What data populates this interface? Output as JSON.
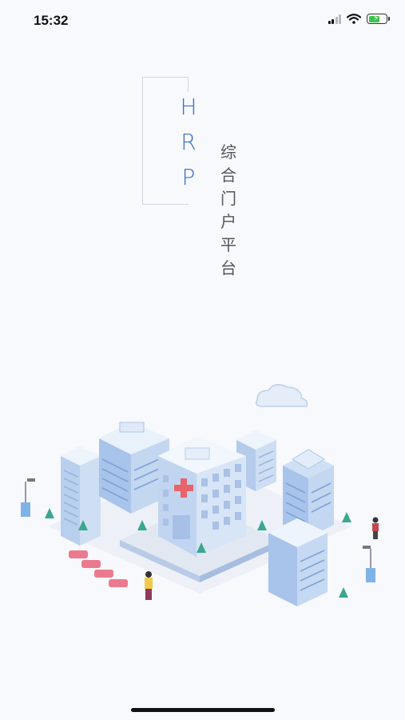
{
  "status_bar": {
    "time": "15:32",
    "battery_level": 0.7
  },
  "brand": {
    "letters": [
      "H",
      "R",
      "P"
    ]
  },
  "subtitle": {
    "chars": [
      "综",
      "合",
      "门",
      "户",
      "平",
      "台"
    ]
  },
  "illustration": {
    "name": "hospital-city-illustration"
  },
  "colors": {
    "accent": "#3a72c6",
    "background": "#f8f9fd",
    "text_secondary": "#555555"
  }
}
